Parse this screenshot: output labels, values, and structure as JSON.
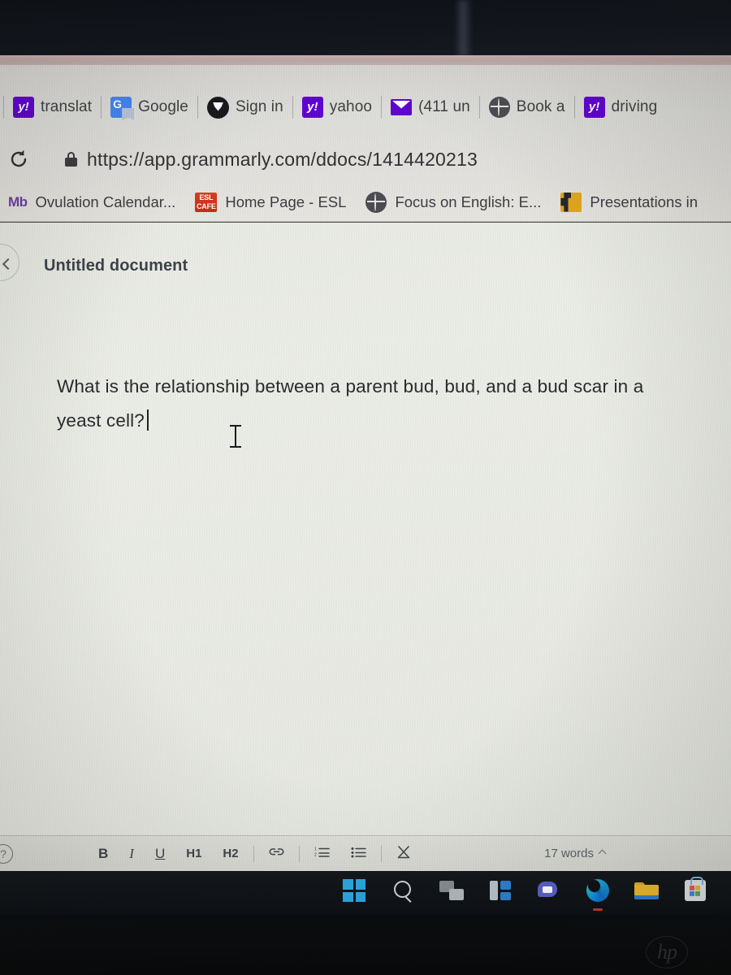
{
  "browser": {
    "reload_icon": "reload-icon",
    "lock_icon": "lock-icon",
    "url": "https://app.grammarly.com/ddocs/1414420213",
    "favorites_row": [
      {
        "icon": "yahoo-icon",
        "icon_glyph": "y!",
        "label": "translat"
      },
      {
        "icon": "google-translate-icon",
        "icon_glyph": "G",
        "label": "Google"
      },
      {
        "icon": "brave-shield-icon",
        "icon_glyph": "",
        "label": "Sign in"
      },
      {
        "icon": "yahoo-icon",
        "icon_glyph": "y!",
        "label": "yahoo"
      },
      {
        "icon": "mail-icon",
        "icon_glyph": "",
        "label": "(411 un"
      },
      {
        "icon": "globe-icon",
        "icon_glyph": "",
        "label": "Book a"
      },
      {
        "icon": "yahoo-icon",
        "icon_glyph": "y!",
        "label": "driving"
      }
    ],
    "bookmarks_row": [
      {
        "icon": "mb-icon",
        "icon_glyph": "Mb",
        "label": "Ovulation Calendar..."
      },
      {
        "icon": "esl-cafe-icon",
        "icon_glyph": "ESL CAFE",
        "label": "Home Page - ESL"
      },
      {
        "icon": "globe-icon",
        "icon_glyph": "",
        "label": "Focus on English: E..."
      },
      {
        "icon": "presentation-icon",
        "icon_glyph": "",
        "label": "Presentations in"
      }
    ]
  },
  "document": {
    "back_icon": "back-chevron-icon",
    "title": "Untitled document",
    "lines": [
      "What is the relationship between a parent bud, bud, and a bud scar in a",
      "yeast cell?"
    ]
  },
  "format_toolbar": {
    "help_icon": "help-icon",
    "bold": "B",
    "italic": "I",
    "underline": "U",
    "heading1": "H1",
    "heading2": "H2",
    "link_icon": "link-icon",
    "numbered_list_icon": "numbered-list-icon",
    "bullet_list_icon": "bullet-list-icon",
    "clear_format_icon": "clear-formatting-icon",
    "word_count": "17 words"
  },
  "taskbar": {
    "items": [
      {
        "icon": "windows-start-icon",
        "label": "Start"
      },
      {
        "icon": "search-icon",
        "label": "Search"
      },
      {
        "icon": "task-view-icon",
        "label": "Task View"
      },
      {
        "icon": "widgets-icon",
        "label": "Widgets"
      },
      {
        "icon": "teams-chat-icon",
        "label": "Chat"
      },
      {
        "icon": "microsoft-edge-icon",
        "label": "Microsoft Edge"
      },
      {
        "icon": "file-explorer-icon",
        "label": "File Explorer"
      },
      {
        "icon": "microsoft-store-icon",
        "label": "Microsoft Store"
      }
    ]
  },
  "device": {
    "brand_logo": "hp"
  },
  "colors": {
    "accent_purple": "#5f01d1",
    "edge_blue": "#0f8ce0",
    "esl_red": "#c22d12",
    "taskbar_bg": "#0f1317",
    "doc_bg": "#eaece5"
  }
}
